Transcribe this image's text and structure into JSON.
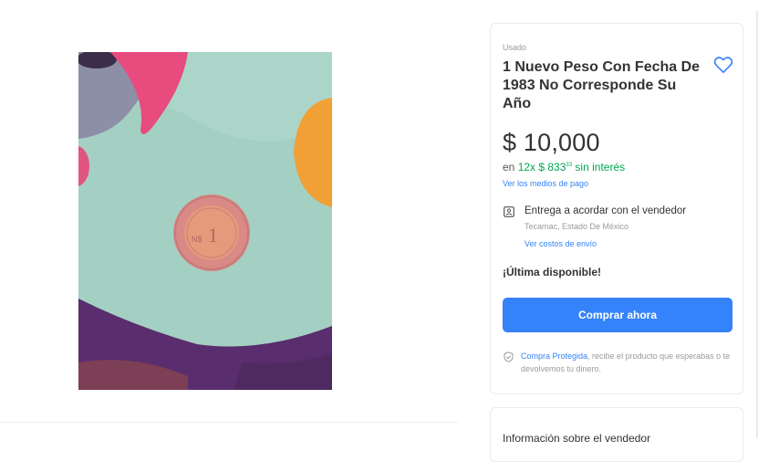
{
  "product": {
    "condition": "Usado",
    "title": "1 Nuevo Peso Con Fecha De 1983 No Corresponde Su Año",
    "price": "$ 10,000",
    "installments": {
      "prefix": "en ",
      "amount": "12x $ 833",
      "cents": "33",
      "suffix": " sin interés"
    },
    "payment_link": "Ver los medios de pago",
    "favorite_icon": "heart-icon"
  },
  "shipping": {
    "title": "Entrega a acordar con el vendedor",
    "location": "Tecamac, Estado De México",
    "costs_link": "Ver costos de envío",
    "icon": "pickup-icon"
  },
  "stock": {
    "label": "¡Última disponible!"
  },
  "actions": {
    "buy_now": "Comprar ahora"
  },
  "protection": {
    "link": "Compra Protegida",
    "text": ", recibe el producto que esperabas o te devolvemos tu dinero.",
    "icon": "shield-icon"
  },
  "seller": {
    "title": "Información sobre el vendedor"
  },
  "colors": {
    "accent": "#3483fa",
    "green": "#00a650"
  }
}
